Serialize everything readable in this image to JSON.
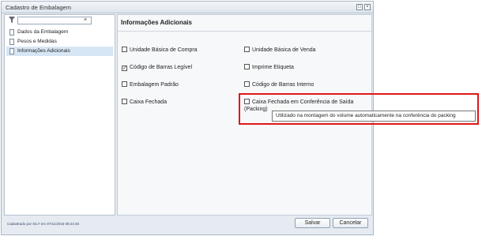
{
  "window": {
    "title": "Cadastro de Embalagem",
    "restore_glyph": "□",
    "close_glyph": "×"
  },
  "sidebar": {
    "filter_value": "",
    "clear_glyph": "×",
    "items": [
      {
        "label": "Dados da Embalagem",
        "active": false
      },
      {
        "label": "Pesos e Medidas",
        "active": false
      },
      {
        "label": "Informações Adicionais",
        "active": true
      }
    ]
  },
  "content": {
    "section_title": "Informações Adicionais",
    "options": [
      {
        "label": "Unidade Básica de Compra",
        "checked": false
      },
      {
        "label": "Unidade Básica de Venda",
        "checked": false
      },
      {
        "label": "Código de Barras Legível",
        "checked": true
      },
      {
        "label": "Imprime Etiqueta",
        "checked": false
      },
      {
        "label": "Embalagem Padrão",
        "checked": false
      },
      {
        "label": "Código de Barras Interno",
        "checked": false
      },
      {
        "label": "Caixa Fechada",
        "checked": false
      },
      {
        "label": "Caixa Fechada em Conferência de Saída (Packing)",
        "checked": false
      }
    ]
  },
  "tooltip": {
    "text": "Utilizado na montagem do volume automaticamente na conferência do packing"
  },
  "footer": {
    "audit_text": "Cadastrado por SILT em 07/11/2016 08:24:46",
    "save_label": "Salvar",
    "cancel_label": "Cancelar"
  },
  "colors": {
    "highlight_border": "#e01818",
    "active_nav_bg": "#d7e6f5"
  }
}
